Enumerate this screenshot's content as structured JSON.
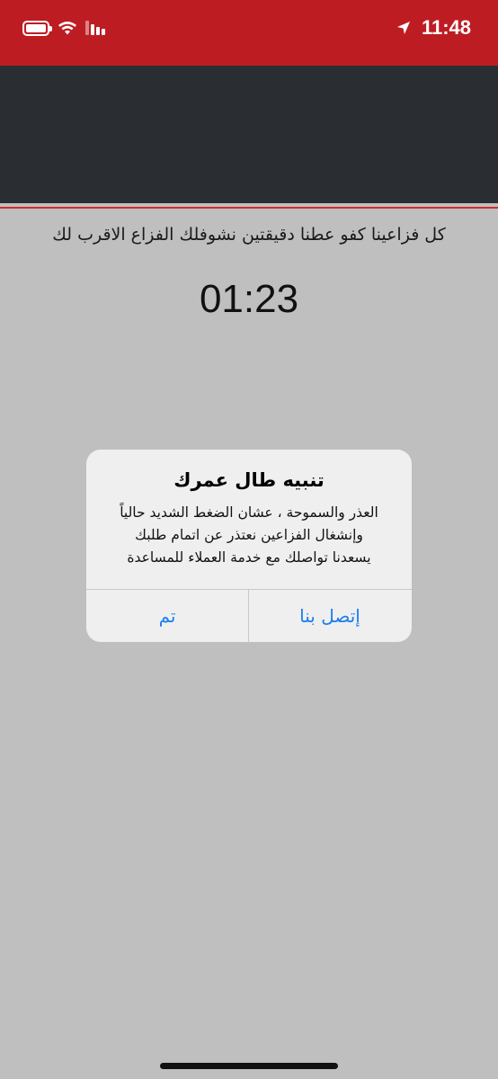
{
  "status_bar": {
    "time": "11:48",
    "battery_icon": "battery-icon",
    "wifi_icon": "wifi-icon",
    "signal_icon": "cellular-signal-icon",
    "location_icon": "location-arrow-icon",
    "color": "#be1c23"
  },
  "header": {
    "background": "#2a2e33",
    "accent_line": "#d62a2a"
  },
  "main": {
    "message": "كل فزاعينا كفو عطنا دقيقتين نشوفلك الفزاع الاقرب لك",
    "countdown": "01:23"
  },
  "alert": {
    "title": "تنبيه طال عمرك",
    "body_lines": [
      "العذر والسموحة ، عشان الضغط الشديد حالياً",
      "وإنشغال الفزاعين نعتذر عن اتمام طلبك",
      "يسعدنا تواصلك مع خدمة العملاء للمساعدة"
    ],
    "buttons": {
      "done": "تم",
      "contact": "إتصل بنا"
    },
    "button_color": "#1a7ff0"
  }
}
